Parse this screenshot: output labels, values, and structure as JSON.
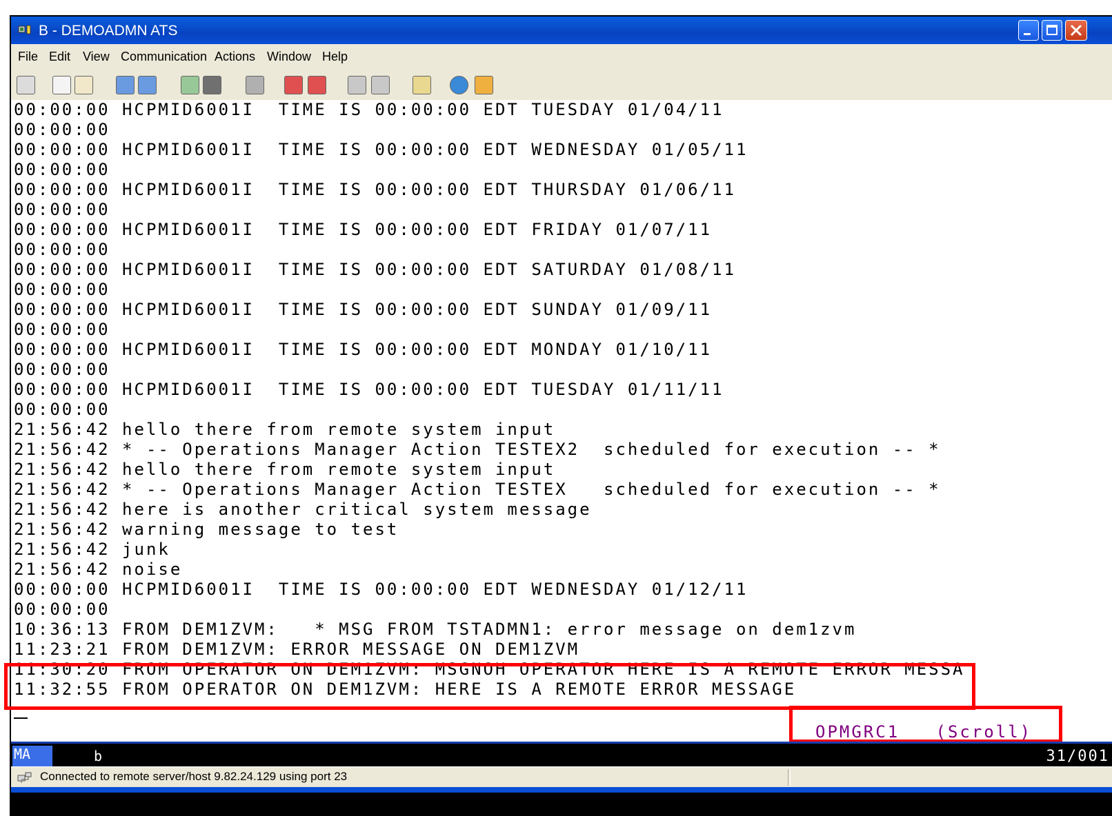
{
  "window": {
    "title": "B - DEMOADMN ATS",
    "app_icon": "3270-session-icon",
    "controls": [
      "minimize-icon",
      "maximize-icon",
      "close-icon"
    ]
  },
  "menu": {
    "items": [
      "File",
      "Edit",
      "View",
      "Communication",
      "Actions",
      "Window",
      "Help"
    ]
  },
  "toolbar": {
    "icons": [
      "display-session-icon",
      "copy-icon",
      "paste-icon",
      "send-file-icon",
      "receive-file-icon",
      "keypad-icon",
      "macro-icon",
      "print-screen-icon",
      "record-macro-icon",
      "stop-macro-icon",
      "play-macro-icon",
      "macro-manager-icon",
      "clipboard-icon",
      "connect-globe-icon",
      "disconnect-icon"
    ]
  },
  "terminal": {
    "lines": [
      "00:00:00 HCPMID6001I  TIME IS 00:00:00 EDT TUESDAY 01/04/11",
      "00:00:00",
      "00:00:00 HCPMID6001I  TIME IS 00:00:00 EDT WEDNESDAY 01/05/11",
      "00:00:00",
      "00:00:00 HCPMID6001I  TIME IS 00:00:00 EDT THURSDAY 01/06/11",
      "00:00:00",
      "00:00:00 HCPMID6001I  TIME IS 00:00:00 EDT FRIDAY 01/07/11",
      "00:00:00",
      "00:00:00 HCPMID6001I  TIME IS 00:00:00 EDT SATURDAY 01/08/11",
      "00:00:00",
      "00:00:00 HCPMID6001I  TIME IS 00:00:00 EDT SUNDAY 01/09/11",
      "00:00:00",
      "00:00:00 HCPMID6001I  TIME IS 00:00:00 EDT MONDAY 01/10/11",
      "00:00:00",
      "00:00:00 HCPMID6001I  TIME IS 00:00:00 EDT TUESDAY 01/11/11",
      "00:00:00",
      "21:56:42 hello there from remote system input",
      "21:56:42 * -- Operations Manager Action TESTEX2  scheduled for execution -- *",
      "21:56:42 hello there from remote system input",
      "21:56:42 * -- Operations Manager Action TESTEX   scheduled for execution -- *",
      "21:56:42 here is another critical system message",
      "21:56:42 warning message to test",
      "21:56:42 junk",
      "21:56:42 noise",
      "00:00:00 HCPMID6001I  TIME IS 00:00:00 EDT WEDNESDAY 01/12/11",
      "00:00:00",
      "10:36:13 FROM DEM1ZVM:   * MSG FROM TSTADMN1: error message on dem1zvm",
      "11:23:21 FROM DEM1ZVM: ERROR MESSAGE ON DEM1ZVM",
      "11:30:20 FROM OPERATOR ON DEM1ZVM: MSGNOH OPERATOR HERE IS A REMOTE ERROR MESSA",
      "11:32:55 FROM OPERATOR ON DEM1ZVM: HERE IS A REMOTE ERROR MESSAGE"
    ],
    "status_label": "OPMGRC1   (Scroll)",
    "highlight_color": "#ff0000",
    "status_color": "#800080"
  },
  "oia": {
    "mode": "MA",
    "session": "b",
    "cursor_position": "31/001"
  },
  "statusbar": {
    "text": "Connected to remote server/host 9.82.24.129 using port 23",
    "icon": "network-connection-icon"
  }
}
